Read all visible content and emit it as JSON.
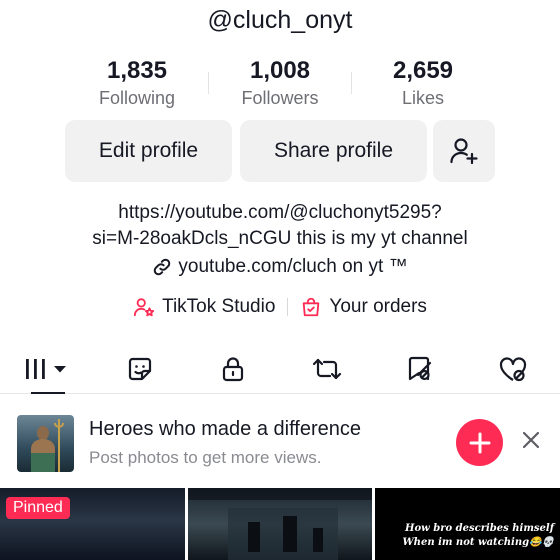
{
  "profile": {
    "username": "@cluch_onyt",
    "stats": [
      {
        "value": "1,835",
        "label": "Following"
      },
      {
        "value": "1,008",
        "label": "Followers"
      },
      {
        "value": "2,659",
        "label": "Likes"
      }
    ],
    "buttons": {
      "edit": "Edit profile",
      "share": "Share profile",
      "add_friend_icon": "add-friend-icon"
    },
    "bio_line1": "https://youtube.com/@cluchonyt5295?",
    "bio_line2": "si=M-28oakDcls_nCGU this is my yt channel",
    "link": "youtube.com/cluch on yt ™",
    "studio": "TikTok Studio",
    "orders": "Your orders"
  },
  "tabs": [
    {
      "icon": "grid-videos-icon",
      "active": true
    },
    {
      "icon": "sticker-icon",
      "active": false
    },
    {
      "icon": "lock-icon",
      "active": false
    },
    {
      "icon": "repost-icon",
      "active": false
    },
    {
      "icon": "bookmark-icon",
      "active": false
    },
    {
      "icon": "liked-heart-icon",
      "active": false
    }
  ],
  "suggestion": {
    "title": "Heroes who made a difference",
    "subtitle": "Post photos to get more views."
  },
  "grid": {
    "pinned_label": "Pinned",
    "meme_line1": "How bro describes himself",
    "meme_line2": "When im not watching😂💀"
  },
  "colors": {
    "accent": "#fe2c55",
    "text": "#161823",
    "muted": "#6e6f75",
    "button_bg": "#f1f1f2"
  }
}
